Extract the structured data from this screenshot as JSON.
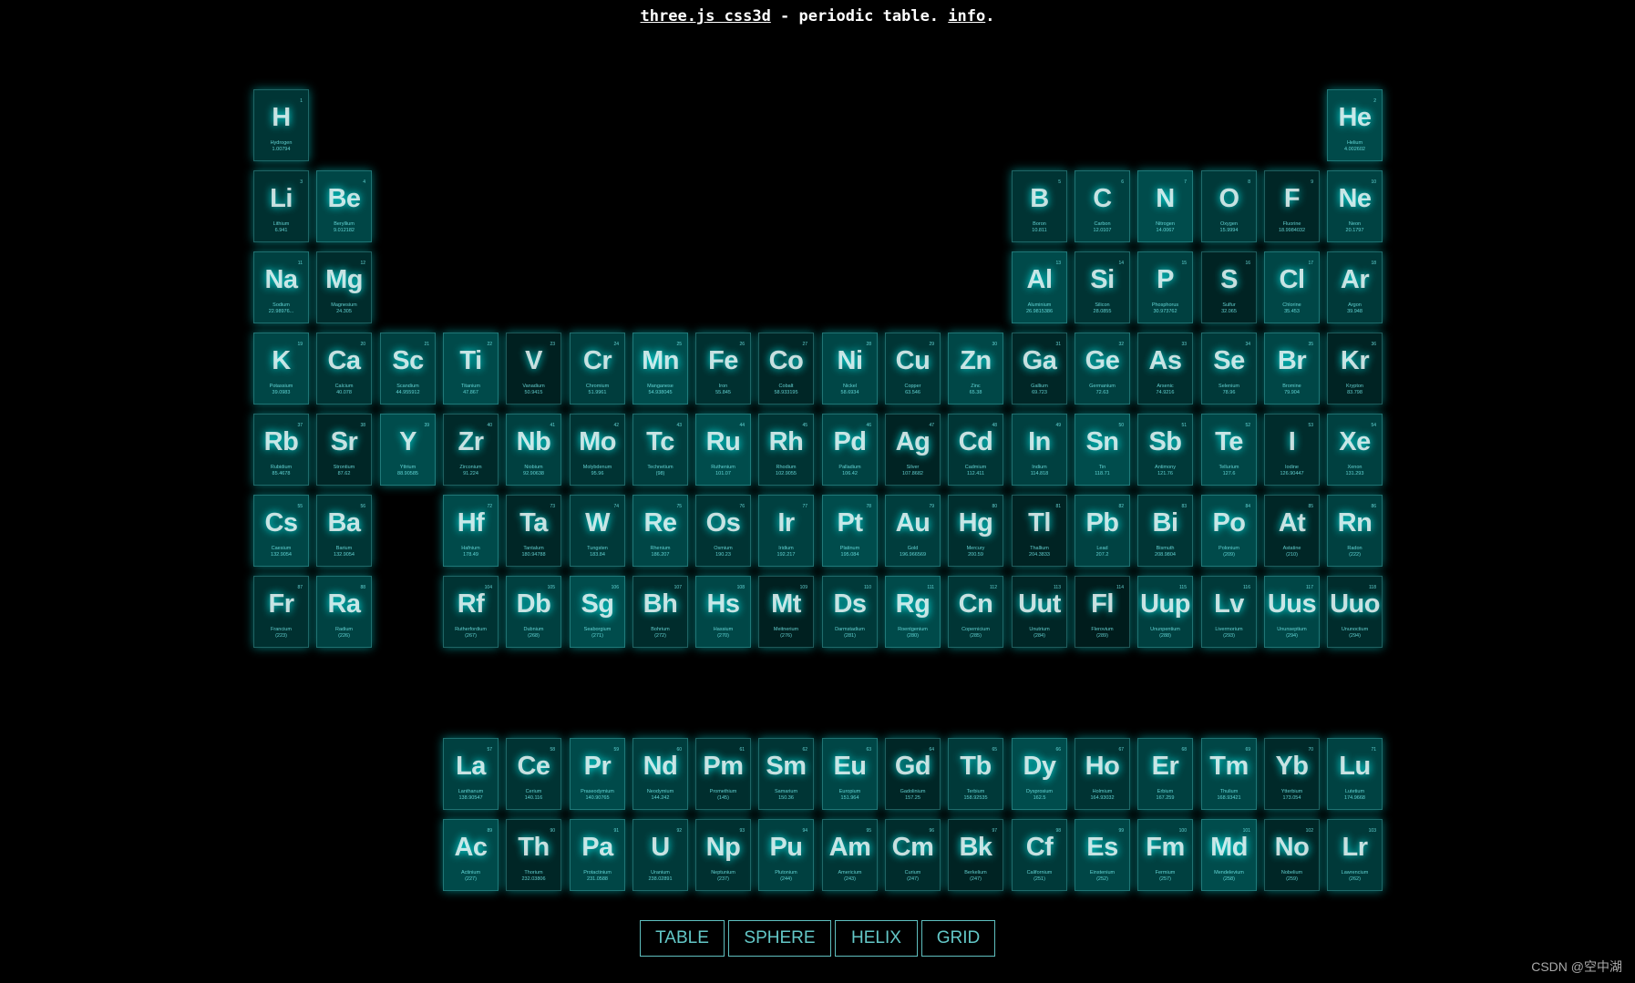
{
  "header": {
    "link_threejs": "three.js css3d",
    "middle_text": " - periodic table. ",
    "link_info": "info",
    "end_text": "."
  },
  "menu": {
    "table": "TABLE",
    "sphere": "SPHERE",
    "helix": "HELIX",
    "grid": "GRID"
  },
  "watermark": "CSDN @空中湖",
  "colors": {
    "accent": "#00ffff",
    "text": "#7fffff",
    "background": "#000000"
  },
  "elements": [
    {
      "n": 1,
      "s": "H",
      "name": "Hydrogen",
      "mass": "1.00794",
      "col": 1,
      "row": 1,
      "tile": 0.42
    },
    {
      "n": 2,
      "s": "He",
      "name": "Helium",
      "mass": "4.002602",
      "col": 18,
      "row": 1,
      "tile": 0.58
    },
    {
      "n": 3,
      "s": "Li",
      "name": "Lithium",
      "mass": "6.941",
      "col": 1,
      "row": 2,
      "tile": 0.38
    },
    {
      "n": 4,
      "s": "Be",
      "name": "Beryllium",
      "mass": "9.012182",
      "col": 2,
      "row": 2,
      "tile": 0.55
    },
    {
      "n": 5,
      "s": "B",
      "name": "Boron",
      "mass": "10.811",
      "col": 13,
      "row": 2,
      "tile": 0.4
    },
    {
      "n": 6,
      "s": "C",
      "name": "Carbon",
      "mass": "12.0107",
      "col": 14,
      "row": 2,
      "tile": 0.5
    },
    {
      "n": 7,
      "s": "N",
      "name": "Nitrogen",
      "mass": "14.0067",
      "col": 15,
      "row": 2,
      "tile": 0.6
    },
    {
      "n": 8,
      "s": "O",
      "name": "Oxygen",
      "mass": "15.9994",
      "col": 16,
      "row": 2,
      "tile": 0.45
    },
    {
      "n": 9,
      "s": "F",
      "name": "Fluorine",
      "mass": "18.9984032",
      "col": 17,
      "row": 2,
      "tile": 0.3
    },
    {
      "n": 10,
      "s": "Ne",
      "name": "Neon",
      "mass": "20.1797",
      "col": 18,
      "row": 2,
      "tile": 0.52
    },
    {
      "n": 11,
      "s": "Na",
      "name": "Sodium",
      "mass": "22.98976...",
      "col": 1,
      "row": 3,
      "tile": 0.5
    },
    {
      "n": 12,
      "s": "Mg",
      "name": "Magnesium",
      "mass": "24.305",
      "col": 2,
      "row": 3,
      "tile": 0.35
    },
    {
      "n": 13,
      "s": "Al",
      "name": "Aluminium",
      "mass": "26.9815386",
      "col": 13,
      "row": 3,
      "tile": 0.58
    },
    {
      "n": 14,
      "s": "Si",
      "name": "Silicon",
      "mass": "28.0855",
      "col": 14,
      "row": 3,
      "tile": 0.4
    },
    {
      "n": 15,
      "s": "P",
      "name": "Phosphorus",
      "mass": "30.973762",
      "col": 15,
      "row": 3,
      "tile": 0.5
    },
    {
      "n": 16,
      "s": "S",
      "name": "Sulfur",
      "mass": "32.065",
      "col": 16,
      "row": 3,
      "tile": 0.28
    },
    {
      "n": 17,
      "s": "Cl",
      "name": "Chlorine",
      "mass": "35.453",
      "col": 17,
      "row": 3,
      "tile": 0.55
    },
    {
      "n": 18,
      "s": "Ar",
      "name": "Argon",
      "mass": "39.948",
      "col": 18,
      "row": 3,
      "tile": 0.45
    },
    {
      "n": 19,
      "s": "K",
      "name": "Potassium",
      "mass": "39.0983",
      "col": 1,
      "row": 4,
      "tile": 0.55
    },
    {
      "n": 20,
      "s": "Ca",
      "name": "Calcium",
      "mass": "40.078",
      "col": 2,
      "row": 4,
      "tile": 0.4
    },
    {
      "n": 21,
      "s": "Sc",
      "name": "Scandium",
      "mass": "44.955912",
      "col": 3,
      "row": 4,
      "tile": 0.5
    },
    {
      "n": 22,
      "s": "Ti",
      "name": "Titanium",
      "mass": "47.867",
      "col": 4,
      "row": 4,
      "tile": 0.58
    },
    {
      "n": 23,
      "s": "V",
      "name": "Vanadium",
      "mass": "50.9415",
      "col": 5,
      "row": 4,
      "tile": 0.25
    },
    {
      "n": 24,
      "s": "Cr",
      "name": "Chromium",
      "mass": "51.9961",
      "col": 6,
      "row": 4,
      "tile": 0.48
    },
    {
      "n": 25,
      "s": "Mn",
      "name": "Manganese",
      "mass": "54.938045",
      "col": 7,
      "row": 4,
      "tile": 0.6
    },
    {
      "n": 26,
      "s": "Fe",
      "name": "Iron",
      "mass": "55.845",
      "col": 8,
      "row": 4,
      "tile": 0.38
    },
    {
      "n": 27,
      "s": "Co",
      "name": "Cobalt",
      "mass": "58.933195",
      "col": 9,
      "row": 4,
      "tile": 0.3
    },
    {
      "n": 28,
      "s": "Ni",
      "name": "Nickel",
      "mass": "58.6934",
      "col": 10,
      "row": 4,
      "tile": 0.55
    },
    {
      "n": 29,
      "s": "Cu",
      "name": "Copper",
      "mass": "63.546",
      "col": 11,
      "row": 4,
      "tile": 0.42
    },
    {
      "n": 30,
      "s": "Zn",
      "name": "Zinc",
      "mass": "65.38",
      "col": 12,
      "row": 4,
      "tile": 0.56
    },
    {
      "n": 31,
      "s": "Ga",
      "name": "Gallium",
      "mass": "69.723",
      "col": 13,
      "row": 4,
      "tile": 0.3
    },
    {
      "n": 32,
      "s": "Ge",
      "name": "Germanium",
      "mass": "72.63",
      "col": 14,
      "row": 4,
      "tile": 0.5
    },
    {
      "n": 33,
      "s": "As",
      "name": "Arsenic",
      "mass": "74.9216",
      "col": 15,
      "row": 4,
      "tile": 0.36
    },
    {
      "n": 34,
      "s": "Se",
      "name": "Selenium",
      "mass": "78.96",
      "col": 16,
      "row": 4,
      "tile": 0.45
    },
    {
      "n": 35,
      "s": "Br",
      "name": "Bromine",
      "mass": "79.904",
      "col": 17,
      "row": 4,
      "tile": 0.55
    },
    {
      "n": 36,
      "s": "Kr",
      "name": "Krypton",
      "mass": "83.798",
      "col": 18,
      "row": 4,
      "tile": 0.28
    },
    {
      "n": 37,
      "s": "Rb",
      "name": "Rubidium",
      "mass": "85.4678",
      "col": 1,
      "row": 5,
      "tile": 0.45
    },
    {
      "n": 38,
      "s": "Sr",
      "name": "Strontium",
      "mass": "87.62",
      "col": 2,
      "row": 5,
      "tile": 0.3
    },
    {
      "n": 39,
      "s": "Y",
      "name": "Yttrium",
      "mass": "88.90585",
      "col": 3,
      "row": 5,
      "tile": 0.6
    },
    {
      "n": 40,
      "s": "Zr",
      "name": "Zirconium",
      "mass": "91.224",
      "col": 4,
      "row": 5,
      "tile": 0.32
    },
    {
      "n": 41,
      "s": "Nb",
      "name": "Niobium",
      "mass": "92.90638",
      "col": 5,
      "row": 5,
      "tile": 0.5
    },
    {
      "n": 42,
      "s": "Mo",
      "name": "Molybdenum",
      "mass": "95.96",
      "col": 6,
      "row": 5,
      "tile": 0.4
    },
    {
      "n": 43,
      "s": "Tc",
      "name": "Technetium",
      "mass": "(98)",
      "col": 7,
      "row": 5,
      "tile": 0.48
    },
    {
      "n": 44,
      "s": "Ru",
      "name": "Ruthenium",
      "mass": "101.07",
      "col": 8,
      "row": 5,
      "tile": 0.6
    },
    {
      "n": 45,
      "s": "Rh",
      "name": "Rhodium",
      "mass": "102.9055",
      "col": 9,
      "row": 5,
      "tile": 0.4
    },
    {
      "n": 46,
      "s": "Pd",
      "name": "Palladium",
      "mass": "106.42",
      "col": 10,
      "row": 5,
      "tile": 0.52
    },
    {
      "n": 47,
      "s": "Ag",
      "name": "Silver",
      "mass": "107.8682",
      "col": 11,
      "row": 5,
      "tile": 0.28
    },
    {
      "n": 48,
      "s": "Cd",
      "name": "Cadmium",
      "mass": "112.411",
      "col": 12,
      "row": 5,
      "tile": 0.42
    },
    {
      "n": 49,
      "s": "In",
      "name": "Indium",
      "mass": "114.818",
      "col": 13,
      "row": 5,
      "tile": 0.5
    },
    {
      "n": 50,
      "s": "Sn",
      "name": "Tin",
      "mass": "118.71",
      "col": 14,
      "row": 5,
      "tile": 0.6
    },
    {
      "n": 51,
      "s": "Sb",
      "name": "Antimony",
      "mass": "121.76",
      "col": 15,
      "row": 5,
      "tile": 0.45
    },
    {
      "n": 52,
      "s": "Te",
      "name": "Tellurium",
      "mass": "127.6",
      "col": 16,
      "row": 5,
      "tile": 0.55
    },
    {
      "n": 53,
      "s": "I",
      "name": "Iodine",
      "mass": "126.90447",
      "col": 17,
      "row": 5,
      "tile": 0.35
    },
    {
      "n": 54,
      "s": "Xe",
      "name": "Xenon",
      "mass": "131.293",
      "col": 18,
      "row": 5,
      "tile": 0.5
    },
    {
      "n": 55,
      "s": "Cs",
      "name": "Caesium",
      "mass": "132.9054",
      "col": 1,
      "row": 6,
      "tile": 0.55
    },
    {
      "n": 56,
      "s": "Ba",
      "name": "Barium",
      "mass": "132.9054",
      "col": 2,
      "row": 6,
      "tile": 0.42
    },
    {
      "n": 72,
      "s": "Hf",
      "name": "Hafnium",
      "mass": "178.49",
      "col": 4,
      "row": 6,
      "tile": 0.58
    },
    {
      "n": 73,
      "s": "Ta",
      "name": "Tantalum",
      "mass": "180.94788",
      "col": 5,
      "row": 6,
      "tile": 0.3
    },
    {
      "n": 74,
      "s": "W",
      "name": "Tungsten",
      "mass": "183.84",
      "col": 6,
      "row": 6,
      "tile": 0.45
    },
    {
      "n": 75,
      "s": "Re",
      "name": "Rhenium",
      "mass": "186.207",
      "col": 7,
      "row": 6,
      "tile": 0.55
    },
    {
      "n": 76,
      "s": "Os",
      "name": "Osmium",
      "mass": "190.23",
      "col": 8,
      "row": 6,
      "tile": 0.4
    },
    {
      "n": 77,
      "s": "Ir",
      "name": "Iridium",
      "mass": "192.217",
      "col": 9,
      "row": 6,
      "tile": 0.5
    },
    {
      "n": 78,
      "s": "Pt",
      "name": "Platinum",
      "mass": "195.084",
      "col": 10,
      "row": 6,
      "tile": 0.6
    },
    {
      "n": 79,
      "s": "Au",
      "name": "Gold",
      "mass": "196.966569",
      "col": 11,
      "row": 6,
      "tile": 0.48
    },
    {
      "n": 80,
      "s": "Hg",
      "name": "Mercury",
      "mass": "200.59",
      "col": 12,
      "row": 6,
      "tile": 0.36
    },
    {
      "n": 81,
      "s": "Tl",
      "name": "Thallium",
      "mass": "204.3833",
      "col": 13,
      "row": 6,
      "tile": 0.28
    },
    {
      "n": 82,
      "s": "Pb",
      "name": "Lead",
      "mass": "207.2",
      "col": 14,
      "row": 6,
      "tile": 0.52
    },
    {
      "n": 83,
      "s": "Bi",
      "name": "Bismuth",
      "mass": "208.9804",
      "col": 15,
      "row": 6,
      "tile": 0.42
    },
    {
      "n": 84,
      "s": "Po",
      "name": "Polonium",
      "mass": "(209)",
      "col": 16,
      "row": 6,
      "tile": 0.58
    },
    {
      "n": 85,
      "s": "At",
      "name": "Astatine",
      "mass": "(210)",
      "col": 17,
      "row": 6,
      "tile": 0.3
    },
    {
      "n": 86,
      "s": "Rn",
      "name": "Radon",
      "mass": "(222)",
      "col": 18,
      "row": 6,
      "tile": 0.5
    },
    {
      "n": 87,
      "s": "Fr",
      "name": "Francium",
      "mass": "(223)",
      "col": 1,
      "row": 7,
      "tile": 0.38
    },
    {
      "n": 88,
      "s": "Ra",
      "name": "Radium",
      "mass": "(226)",
      "col": 2,
      "row": 7,
      "tile": 0.52
    },
    {
      "n": 104,
      "s": "Rf",
      "name": "Rutherfordium",
      "mass": "(267)",
      "col": 4,
      "row": 7,
      "tile": 0.4
    },
    {
      "n": 105,
      "s": "Db",
      "name": "Dubnium",
      "mass": "(268)",
      "col": 5,
      "row": 7,
      "tile": 0.5
    },
    {
      "n": 106,
      "s": "Sg",
      "name": "Seaborgium",
      "mass": "(271)",
      "col": 6,
      "row": 7,
      "tile": 0.6
    },
    {
      "n": 107,
      "s": "Bh",
      "name": "Bohrium",
      "mass": "(272)",
      "col": 7,
      "row": 7,
      "tile": 0.35
    },
    {
      "n": 108,
      "s": "Hs",
      "name": "Hassium",
      "mass": "(270)",
      "col": 8,
      "row": 7,
      "tile": 0.56
    },
    {
      "n": 109,
      "s": "Mt",
      "name": "Meitnerium",
      "mass": "(276)",
      "col": 9,
      "row": 7,
      "tile": 0.25
    },
    {
      "n": 110,
      "s": "Ds",
      "name": "Darmstadium",
      "mass": "(281)",
      "col": 10,
      "row": 7,
      "tile": 0.45
    },
    {
      "n": 111,
      "s": "Rg",
      "name": "Roentgenium",
      "mass": "(280)",
      "col": 11,
      "row": 7,
      "tile": 0.58
    },
    {
      "n": 112,
      "s": "Cn",
      "name": "Copernicium",
      "mass": "(285)",
      "col": 12,
      "row": 7,
      "tile": 0.42
    },
    {
      "n": 113,
      "s": "Uut",
      "name": "Unutrium",
      "mass": "(284)",
      "col": 13,
      "row": 7,
      "tile": 0.3
    },
    {
      "n": 114,
      "s": "Fl",
      "name": "Flerovium",
      "mass": "(289)",
      "col": 14,
      "row": 7,
      "tile": 0.22
    },
    {
      "n": 115,
      "s": "Uup",
      "name": "Ununpentium",
      "mass": "(288)",
      "col": 15,
      "row": 7,
      "tile": 0.5
    },
    {
      "n": 116,
      "s": "Lv",
      "name": "Livermorium",
      "mass": "(293)",
      "col": 16,
      "row": 7,
      "tile": 0.45
    },
    {
      "n": 117,
      "s": "Uus",
      "name": "Ununseptium",
      "mass": "(294)",
      "col": 17,
      "row": 7,
      "tile": 0.55
    },
    {
      "n": 118,
      "s": "Uuo",
      "name": "Ununoctium",
      "mass": "(294)",
      "col": 18,
      "row": 7,
      "tile": 0.35
    },
    {
      "n": 57,
      "s": "La",
      "name": "Lanthanum",
      "mass": "138.90547",
      "col": 4,
      "row": 9,
      "tile": 0.5
    },
    {
      "n": 58,
      "s": "Ce",
      "name": "Cerium",
      "mass": "140.116",
      "col": 5,
      "row": 9,
      "tile": 0.4
    },
    {
      "n": 59,
      "s": "Pr",
      "name": "Praseodymium",
      "mass": "140.90765",
      "col": 6,
      "row": 9,
      "tile": 0.58
    },
    {
      "n": 60,
      "s": "Nd",
      "name": "Neodymium",
      "mass": "144.242",
      "col": 7,
      "row": 9,
      "tile": 0.48
    },
    {
      "n": 61,
      "s": "Pm",
      "name": "Promethium",
      "mass": "(145)",
      "col": 8,
      "row": 9,
      "tile": 0.36
    },
    {
      "n": 62,
      "s": "Sm",
      "name": "Samarium",
      "mass": "150.36",
      "col": 9,
      "row": 9,
      "tile": 0.42
    },
    {
      "n": 63,
      "s": "Eu",
      "name": "Europium",
      "mass": "151.964",
      "col": 10,
      "row": 9,
      "tile": 0.55
    },
    {
      "n": 64,
      "s": "Gd",
      "name": "Gadolinium",
      "mass": "157.25",
      "col": 11,
      "row": 9,
      "tile": 0.3
    },
    {
      "n": 65,
      "s": "Tb",
      "name": "Terbium",
      "mass": "158.92535",
      "col": 12,
      "row": 9,
      "tile": 0.45
    },
    {
      "n": 66,
      "s": "Dy",
      "name": "Dysprosium",
      "mass": "162.5",
      "col": 13,
      "row": 9,
      "tile": 0.6
    },
    {
      "n": 67,
      "s": "Ho",
      "name": "Holmium",
      "mass": "164.93032",
      "col": 14,
      "row": 9,
      "tile": 0.4
    },
    {
      "n": 68,
      "s": "Er",
      "name": "Erbium",
      "mass": "167.259",
      "col": 15,
      "row": 9,
      "tile": 0.5
    },
    {
      "n": 69,
      "s": "Tm",
      "name": "Thulium",
      "mass": "168.93421",
      "col": 16,
      "row": 9,
      "tile": 0.55
    },
    {
      "n": 70,
      "s": "Yb",
      "name": "Ytterbium",
      "mass": "173.054",
      "col": 17,
      "row": 9,
      "tile": 0.32
    },
    {
      "n": 71,
      "s": "Lu",
      "name": "Lutetium",
      "mass": "174.9668",
      "col": 18,
      "row": 9,
      "tile": 0.52
    },
    {
      "n": 89,
      "s": "Ac",
      "name": "Actinium",
      "mass": "(227)",
      "col": 4,
      "row": 10,
      "tile": 0.58
    },
    {
      "n": 90,
      "s": "Th",
      "name": "Thorium",
      "mass": "232.03806",
      "col": 5,
      "row": 10,
      "tile": 0.3
    },
    {
      "n": 91,
      "s": "Pa",
      "name": "Protactinium",
      "mass": "231.0588",
      "col": 6,
      "row": 10,
      "tile": 0.55
    },
    {
      "n": 92,
      "s": "U",
      "name": "Uranium",
      "mass": "238.02891",
      "col": 7,
      "row": 10,
      "tile": 0.45
    },
    {
      "n": 93,
      "s": "Np",
      "name": "Neptunium",
      "mass": "(237)",
      "col": 8,
      "row": 10,
      "tile": 0.38
    },
    {
      "n": 94,
      "s": "Pu",
      "name": "Plutonium",
      "mass": "(244)",
      "col": 9,
      "row": 10,
      "tile": 0.5
    },
    {
      "n": 95,
      "s": "Am",
      "name": "Americium",
      "mass": "(243)",
      "col": 10,
      "row": 10,
      "tile": 0.42
    },
    {
      "n": 96,
      "s": "Cm",
      "name": "Curium",
      "mass": "(247)",
      "col": 11,
      "row": 10,
      "tile": 0.35
    },
    {
      "n": 97,
      "s": "Bk",
      "name": "Berkelium",
      "mass": "(247)",
      "col": 12,
      "row": 10,
      "tile": 0.28
    },
    {
      "n": 98,
      "s": "Cf",
      "name": "Californium",
      "mass": "(251)",
      "col": 13,
      "row": 10,
      "tile": 0.45
    },
    {
      "n": 99,
      "s": "Es",
      "name": "Einstenium",
      "mass": "(252)",
      "col": 14,
      "row": 10,
      "tile": 0.55
    },
    {
      "n": 100,
      "s": "Fm",
      "name": "Fermium",
      "mass": "(257)",
      "col": 15,
      "row": 10,
      "tile": 0.5
    },
    {
      "n": 101,
      "s": "Md",
      "name": "Mendelevium",
      "mass": "(258)",
      "col": 16,
      "row": 10,
      "tile": 0.6
    },
    {
      "n": 102,
      "s": "No",
      "name": "Nobelium",
      "mass": "(259)",
      "col": 17,
      "row": 10,
      "tile": 0.3
    },
    {
      "n": 103,
      "s": "Lr",
      "name": "Lawrencium",
      "mass": "(262)",
      "col": 18,
      "row": 10,
      "tile": 0.45
    }
  ]
}
